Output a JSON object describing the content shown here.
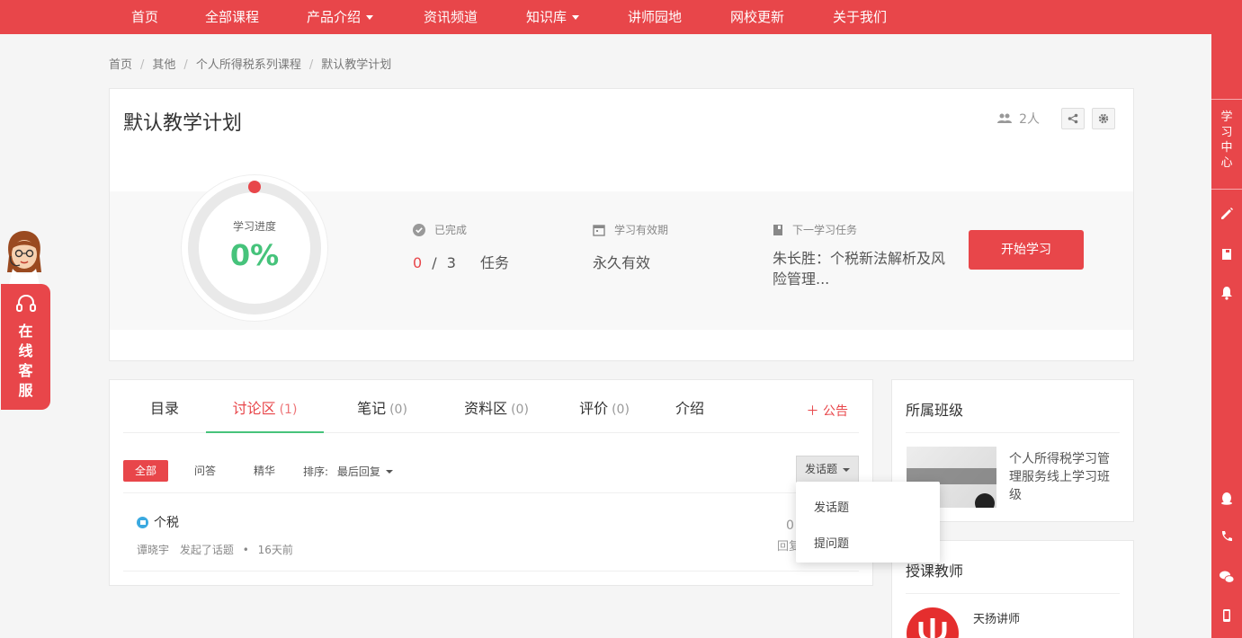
{
  "nav": {
    "items": [
      {
        "label": "首页",
        "dropdown": false
      },
      {
        "label": "全部课程",
        "dropdown": false
      },
      {
        "label": "产品介绍",
        "dropdown": true
      },
      {
        "label": "资讯频道",
        "dropdown": false
      },
      {
        "label": "知识库",
        "dropdown": true
      },
      {
        "label": "讲师园地",
        "dropdown": false
      },
      {
        "label": "网校更新",
        "dropdown": false
      },
      {
        "label": "关于我们",
        "dropdown": false
      }
    ]
  },
  "sidebar": {
    "study_center": "学习中心",
    "icons": [
      "pencil-icon",
      "notebook-icon",
      "bell-icon",
      "qq-icon",
      "phone-icon",
      "wechat-icon",
      "mobile-icon"
    ]
  },
  "breadcrumb": [
    "首页",
    "其他",
    "个人所得税系列课程",
    "默认教学计划"
  ],
  "plan": {
    "title": "默认教学计划",
    "members": "2人",
    "progress_label": "学习进度",
    "progress_value": "0%",
    "progress_fraction": 0,
    "completed_label": "已完成",
    "completed_done": "0",
    "completed_sep": "/",
    "completed_total": "3",
    "completed_unit": "任务",
    "validity_label": "学习有效期",
    "validity_value": "永久有效",
    "next_label": "下一学习任务",
    "next_value": "朱长胜：个税新法解析及风险管理...",
    "start_button": "开始学习"
  },
  "tabs": [
    {
      "label": "目录",
      "count": ""
    },
    {
      "label": "讨论区",
      "count": "(1)"
    },
    {
      "label": "笔记",
      "count": "(0)"
    },
    {
      "label": "资料区",
      "count": "(0)"
    },
    {
      "label": "评价",
      "count": "(0)"
    },
    {
      "label": "介绍",
      "count": ""
    }
  ],
  "announce": "＋ 公告",
  "filters": {
    "all": "全部",
    "qa": "问答",
    "featured": "精华",
    "sort_label": "排序:",
    "sort_value": "最后回复",
    "post_button": "发话题"
  },
  "topic": {
    "title": "个税",
    "author": "谭晓宇",
    "action": "发起了话题",
    "dot": "•",
    "time": "16天前",
    "count": "0",
    "count_label": "回复"
  },
  "dropdown": [
    "发话题",
    "提问题"
  ],
  "class_card": {
    "title": "所属班级",
    "class_name": "个人所得税学习管理服务线上学习班级"
  },
  "teacher_card": {
    "title": "授课教师",
    "teacher_name": "天扬讲师"
  },
  "customer_service": "在线客服",
  "colors": {
    "brand": "#e8464a",
    "progress": "#46c37b"
  }
}
